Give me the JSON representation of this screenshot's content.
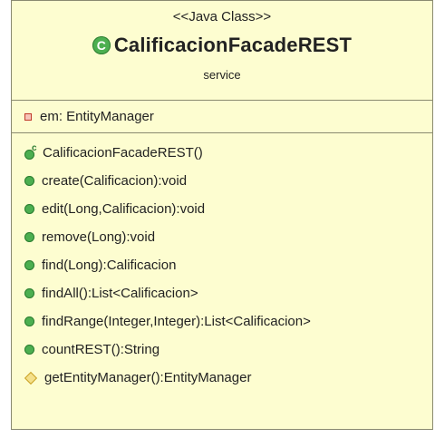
{
  "header": {
    "stereotype": "<<Java Class>>",
    "class_name": "CalificacionFacadeREST",
    "package": "service"
  },
  "attributes": [
    {
      "text": "em: EntityManager",
      "icon": "private-field-icon"
    }
  ],
  "methods": [
    {
      "text": "CalificacionFacadeREST()",
      "icon": "constructor-icon"
    },
    {
      "text": "create(Calificacion):void",
      "icon": "public-method-icon"
    },
    {
      "text": "edit(Long,Calificacion):void",
      "icon": "public-method-icon"
    },
    {
      "text": "remove(Long):void",
      "icon": "public-method-icon"
    },
    {
      "text": "find(Long):Calificacion",
      "icon": "public-method-icon"
    },
    {
      "text": "findAll():List<Calificacion>",
      "icon": "public-method-icon"
    },
    {
      "text": "findRange(Integer,Integer):List<Calificacion>",
      "icon": "public-method-icon"
    },
    {
      "text": "countREST():String",
      "icon": "public-method-icon"
    },
    {
      "text": "getEntityManager():EntityManager",
      "icon": "protected-method-icon"
    }
  ],
  "colors": {
    "box_fill": "#fdfdd0",
    "border": "#8a8a70",
    "public_icon": "#4caf50",
    "protected_icon": "#f4e08a",
    "private_icon": "#c0392b"
  }
}
